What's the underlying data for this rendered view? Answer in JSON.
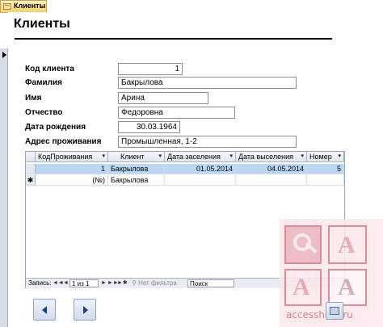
{
  "window": {
    "tab_title": "Клиенты"
  },
  "form": {
    "title": "Клиенты",
    "fields": {
      "client_id": {
        "label": "Код клиента",
        "value": "1"
      },
      "last_name": {
        "label": "Фамилия",
        "value": "Бакрылова"
      },
      "first_name": {
        "label": "Имя",
        "value": "Арина"
      },
      "patronymic": {
        "label": "Отчество",
        "value": "Федоровна"
      },
      "birth_date": {
        "label": "Дата рождения",
        "value": "30.03.1964"
      },
      "address": {
        "label": "Адрес проживания",
        "value": "Промышленная, 1-2"
      }
    }
  },
  "subform": {
    "columns": [
      "КодПроживания",
      "Клиент",
      "Дата заселения",
      "Дата выселения",
      "Номер"
    ],
    "dropdown_glyph": "▾",
    "rows": [
      {
        "id": "1",
        "client": "Бакрылова",
        "checkin": "01.05.2014",
        "checkout": "04.05.2014",
        "room": "5"
      }
    ],
    "new_row": {
      "marker": "✱",
      "id": "(№)",
      "client": "Бакрылова"
    }
  },
  "navigator": {
    "label": "Запись:",
    "first": "◄◄",
    "prev": "◄",
    "position": "1 из 1",
    "next": "►",
    "last": "►►",
    "new": "►✱",
    "filter": "Нет фильтра",
    "search_placeholder": "Поиск"
  },
  "watermark": {
    "text": "accesshelp.ru"
  }
}
